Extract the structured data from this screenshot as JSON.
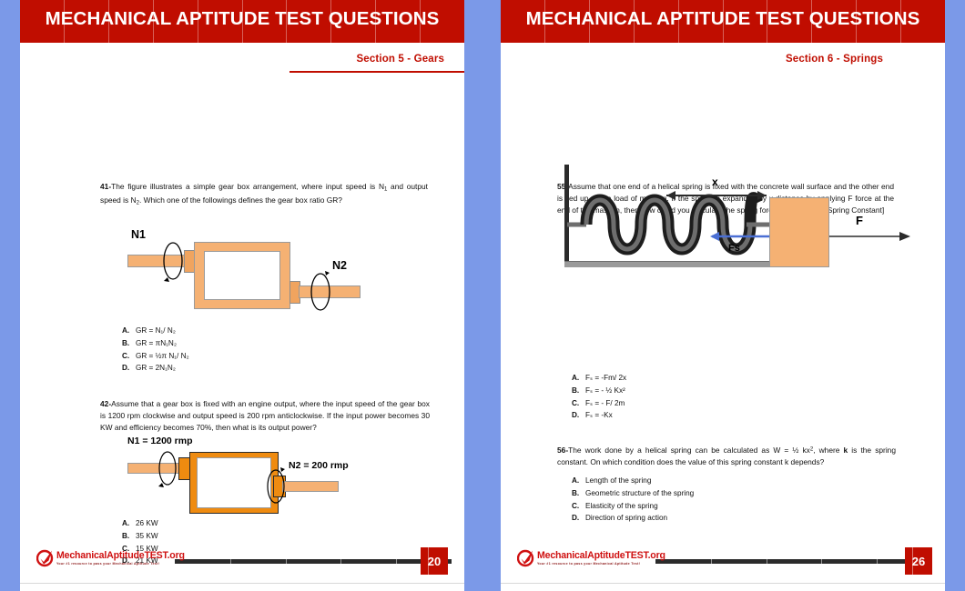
{
  "document": {
    "background_color": "#7b99e8",
    "banner_color": "#c00d00",
    "accent_color": "#c00d00",
    "figure_fill": "#f5b173"
  },
  "pages": [
    {
      "banner_title": "MECHANICAL APTITUDE TEST QUESTIONS",
      "section_label": "Section 5 - Gears",
      "page_number": "20",
      "questions": [
        {
          "number": "41-",
          "text": "The figure illustrates a simple gear box arrangement, where input speed is N₁ and output speed is N₂. Which one of the followings defines the gear box ratio GR?",
          "options": [
            {
              "label": "A.",
              "text": "GR = N₁/ N₂"
            },
            {
              "label": "B.",
              "text": "GR = πN₁N₂"
            },
            {
              "label": "C.",
              "text": "GR = ½π N₁/ N₂"
            },
            {
              "label": "D.",
              "text": "GR = 2N₁N₂"
            }
          ],
          "figure": {
            "type": "gearbox",
            "input_label": "N1",
            "output_label": "N2"
          }
        },
        {
          "number": "42-",
          "text": "Assume that a gear box is fixed with an engine output, where the input speed of the gear box is 1200 rpm clockwise and output speed is 200 rpm anticlockwise. If the input power becomes 30 KW and efficiency becomes 70%, then what is its output power?",
          "options": [
            {
              "label": "A.",
              "text": "26 KW"
            },
            {
              "label": "B.",
              "text": "35 KW"
            },
            {
              "label": "C.",
              "text": "15 KW"
            },
            {
              "label": "D.",
              "text": "21 KW"
            }
          ],
          "figure": {
            "type": "gearbox",
            "input_label": "N1 = 1200 rmp",
            "output_label": "N2 = 200 rmp"
          }
        }
      ]
    },
    {
      "banner_title": "MECHANICAL APTITUDE TEST QUESTIONS",
      "section_label": "Section 6 - Springs",
      "page_number": "26",
      "questions": [
        {
          "number": "55-",
          "text": "Assume that one end of a helical spring is fixed with the concrete wall surface and the other end is tied up with a load of mass m. If the spring is expanded by x distance by applying F force at the end of the mass m, then how could you calculate the spring force Fₛ? [Consider Spring Constant]",
          "options": [
            {
              "label": "A.",
              "text": "Fₛ = -Fm/ 2x"
            },
            {
              "label": "B.",
              "text": "Fₛ = - ½ Kx²"
            },
            {
              "label": "C.",
              "text": "Fₛ = - F/ 2m"
            },
            {
              "label": "D.",
              "text": "Fₛ = -Kx"
            }
          ],
          "figure": {
            "type": "spring-mass",
            "distance_label": "x",
            "applied_force_label": "F",
            "spring_force_label": "Fs"
          }
        },
        {
          "number": "56-",
          "text": "The work done by a helical spring can be calculated as W = ½ kx², where k is the spring constant. On which condition does the value of this spring constant k depends?",
          "options": [
            {
              "label": "A.",
              "text": "Length of the spring"
            },
            {
              "label": "B.",
              "text": "Geometric structure of the spring"
            },
            {
              "label": "C.",
              "text": "Elasticity of the spring"
            },
            {
              "label": "D.",
              "text": "Direction of spring action"
            }
          ]
        }
      ]
    }
  ],
  "footer": {
    "logo_text_primary": "MechanicalAptitude",
    "logo_text_secondary": "TEST.org",
    "logo_tagline": "Your #1 resource to pass your Mechanical Aptitude Test!"
  }
}
